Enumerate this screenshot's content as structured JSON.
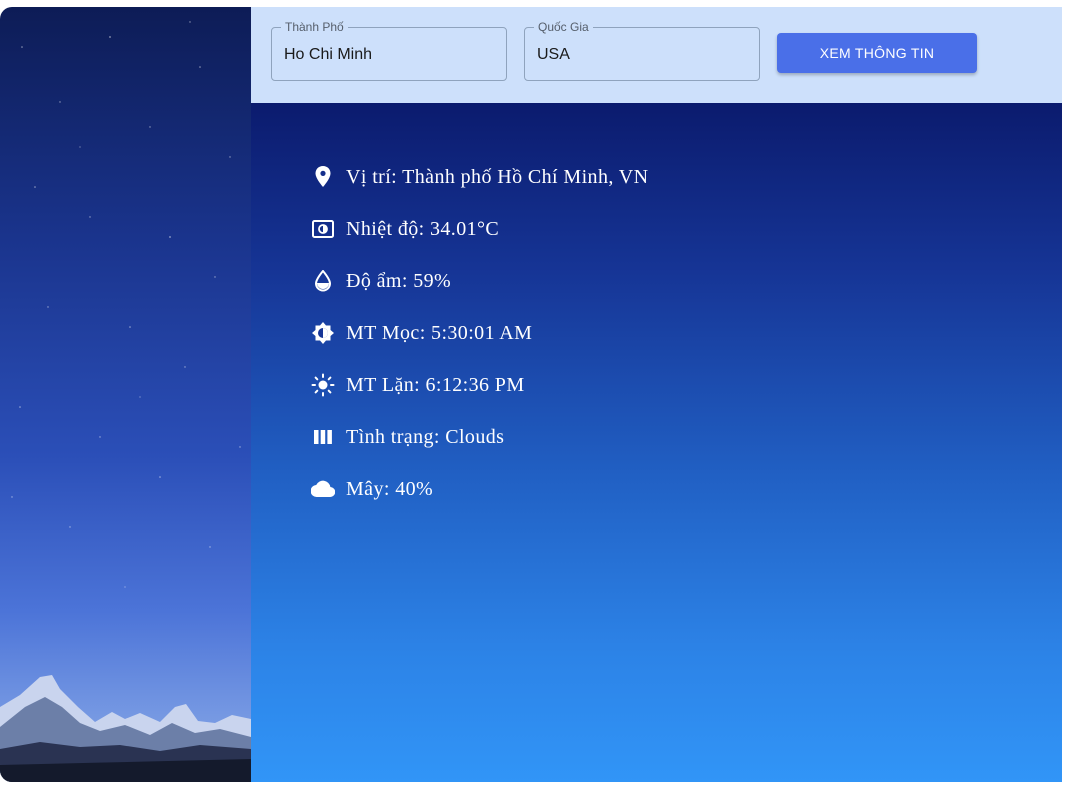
{
  "search": {
    "city": {
      "label": "Thành Phố",
      "value": "Ho Chi Minh"
    },
    "country": {
      "label": "Quốc Gia",
      "value": "USA"
    },
    "button_label": "XEM THÔNG TIN"
  },
  "weather": [
    {
      "icon": "location-pin-icon",
      "text": "Vị trí: Thành phố Hồ Chí Minh, VN"
    },
    {
      "icon": "thermometer-icon",
      "text": "Nhiệt độ: 34.01°C"
    },
    {
      "icon": "water-drop-icon",
      "text": "Độ ẩm: 59%"
    },
    {
      "icon": "sunrise-icon",
      "text": "MT Mọc: 5:30:01 AM"
    },
    {
      "icon": "sunset-icon",
      "text": "MT Lặn: 6:12:36 PM"
    },
    {
      "icon": "condition-icon",
      "text": "Tình trạng: Clouds"
    },
    {
      "icon": "cloud-icon",
      "text": "Mây: 40%"
    }
  ],
  "colors": {
    "topbar_bg": "#cde0fb",
    "button_bg": "#4a6fe8",
    "content_top": "#0b1b6e",
    "content_bottom": "#3195f7"
  }
}
